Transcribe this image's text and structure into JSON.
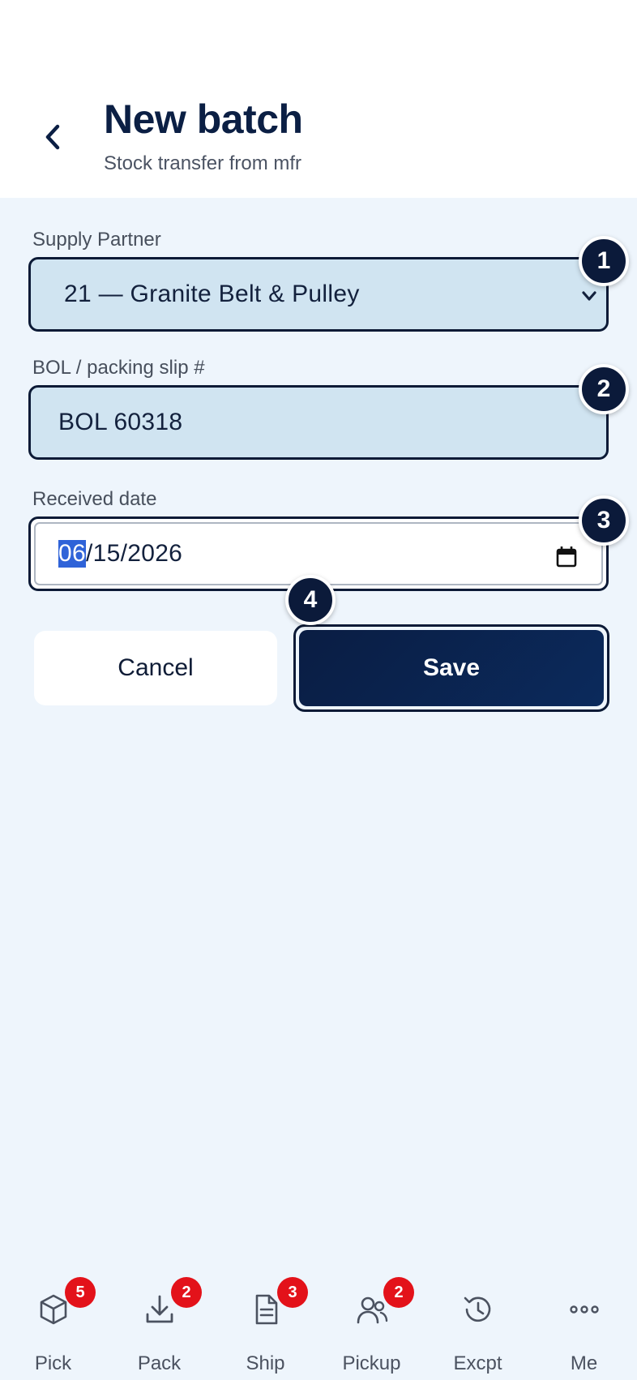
{
  "header": {
    "title": "New batch",
    "subtitle": "Stock transfer from mfr",
    "back_icon": "chevron-left-icon"
  },
  "form": {
    "supplier": {
      "label": "Supply Partner",
      "value": "21 — Granite Belt & Pulley",
      "badge": "1"
    },
    "bol": {
      "label": "BOL / packing slip #",
      "value": "BOL 60318",
      "badge": "2"
    },
    "date": {
      "label": "Received date",
      "month": "06",
      "rest": "/15/2026",
      "badge": "3"
    }
  },
  "actions": {
    "cancel_label": "Cancel",
    "save_label": "Save",
    "save_badge": "4"
  },
  "tabs": [
    {
      "label": "Pick",
      "icon": "box-icon",
      "badge": "5"
    },
    {
      "label": "Pack",
      "icon": "download-icon",
      "badge": "2"
    },
    {
      "label": "Ship",
      "icon": "document-icon",
      "badge": "3"
    },
    {
      "label": "Pickup",
      "icon": "users-icon",
      "badge": "2"
    },
    {
      "label": "Excpt",
      "icon": "history-icon",
      "badge": ""
    },
    {
      "label": "Me",
      "icon": "more-icon",
      "badge": ""
    }
  ],
  "colors": {
    "primary": "#0b1f44",
    "badge_red": "#e3121a",
    "field_fill": "#d0e4f1",
    "page_bg": "#eef5fc"
  }
}
